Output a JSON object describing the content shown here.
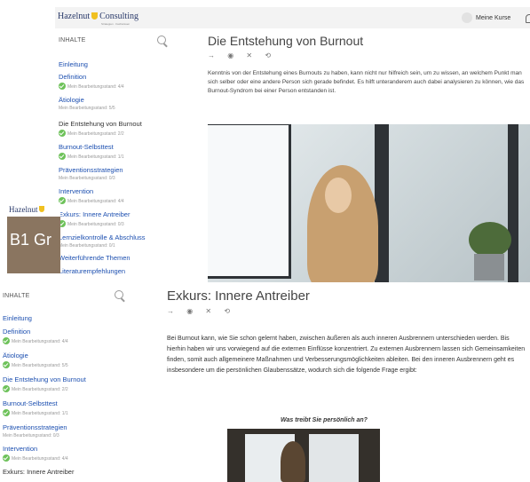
{
  "header": {
    "logo_text": "Hazelnut",
    "logo_text2": "Consulting",
    "logo_sub": "Strategien · Fachwissen",
    "user_label": "Meine Kurse"
  },
  "sidebar": {
    "heading": "INHALTE",
    "items": [
      {
        "label": "Einleitung",
        "status": ""
      },
      {
        "label": "Definition",
        "status": "Mein Bearbeitungsstand: 4/4"
      },
      {
        "label": "Ätiologie",
        "status": "Mein Bearbeitungsstand: 5/5"
      },
      {
        "label": "Die Entstehung von Burnout",
        "status": "Mein Bearbeitungsstand: 2/2"
      },
      {
        "label": "Burnout-Selbsttest",
        "status": "Mein Bearbeitungsstand: 1/1"
      },
      {
        "label": "Präventionsstrategien",
        "status": "Mein Bearbeitungsstand: 0/3"
      },
      {
        "label": "Intervention",
        "status": "Mein Bearbeitungsstand: 4/4"
      },
      {
        "label": "Exkurs: Innere Antreiber",
        "status": "Mein Bearbeitungsstand: 0/3"
      },
      {
        "label": "Lernzielkontrolle & Abschluss",
        "status": "Mein Bearbeitungsstand: 0/1"
      },
      {
        "label": "Weiterführende Themen",
        "status": ""
      },
      {
        "label": "Literaturempfehlungen",
        "status": ""
      }
    ]
  },
  "page1": {
    "title": "Die Entstehung von Burnout",
    "icons": "→ ◉ ✕ ⟲",
    "body": "Kenntnis von der Entstehung eines Burnouts zu haben, kann nicht nur hilfreich sein, um zu wissen, an welchem Punkt man sich selber oder eine andere Person sich gerade befindet. Es hilft unteranderem auch dabei analysieren zu können, wie das Burnout-Syndrom bei einer Person entstanden ist."
  },
  "fragment": {
    "logo": "Hazelnut",
    "text": "B1 Gr"
  },
  "page2": {
    "title": "Exkurs: Innere Antreiber",
    "icons": "→ ◉ ✕ ⟲",
    "body": "Bei Burnout kann, wie Sie schon gelernt haben, zwischen äußeren als auch inneren Ausbrennern unterschieden werden. Bis hierhin haben wir uns vorwiegend auf die externen Einflüsse konzentriert. Zu externen Ausbrennern lassen sich Gemeinsamkeiten finden, somit auch allgemeinere Maßnahmen und Verbesserungsmöglichkeiten ableiten. Bei den inneren Ausbrennern geht es insbesondere um die persönlichen Glaubenssätze, wodurch sich die folgende Frage ergibt:",
    "caption": "Was treibt Sie persönlich an?"
  },
  "colors": {
    "link": "#1c4fb0",
    "check": "#6ec25a",
    "shield": "#f0c020"
  }
}
